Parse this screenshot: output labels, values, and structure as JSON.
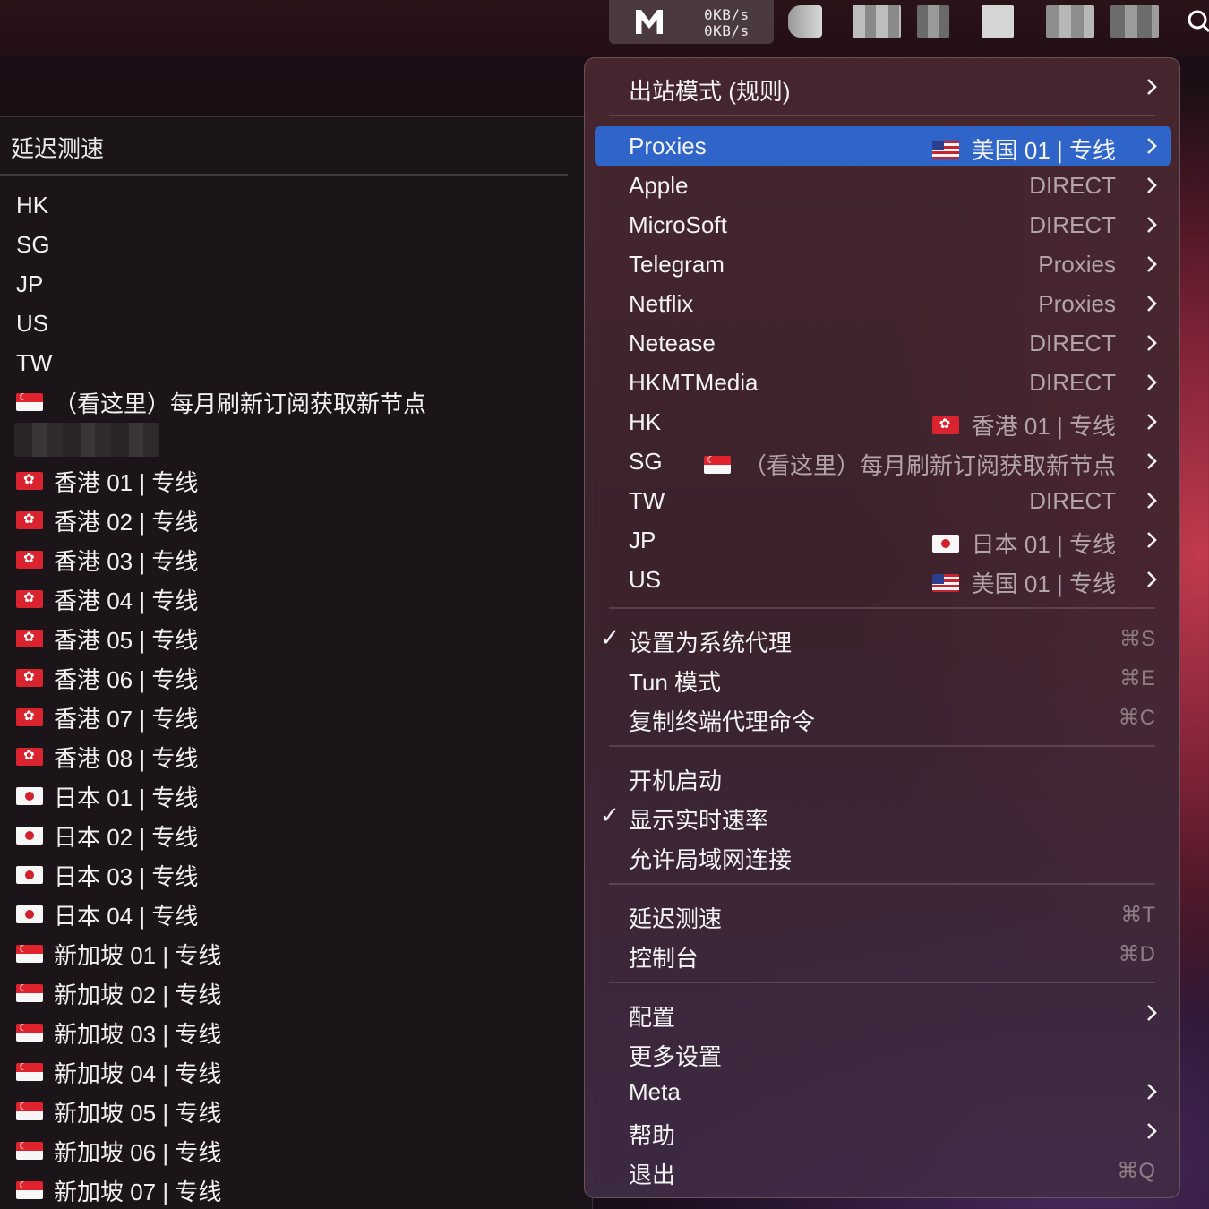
{
  "menubar": {
    "upload_speed": "0KB/s",
    "download_speed": "0KB/s"
  },
  "left_menu": {
    "title": "延迟测速",
    "items": [
      {
        "label": "HK",
        "flag": ""
      },
      {
        "label": "SG",
        "flag": ""
      },
      {
        "label": "JP",
        "flag": ""
      },
      {
        "label": "US",
        "flag": ""
      },
      {
        "label": "TW",
        "flag": ""
      },
      {
        "label": "（看这里）每月刷新订阅获取新节点",
        "flag": "sg"
      },
      {
        "label": "香港 01 | 专线",
        "flag": "hk"
      },
      {
        "label": "香港 02 | 专线",
        "flag": "hk"
      },
      {
        "label": "香港 03 | 专线",
        "flag": "hk"
      },
      {
        "label": "香港 04 | 专线",
        "flag": "hk"
      },
      {
        "label": "香港 05 | 专线",
        "flag": "hk"
      },
      {
        "label": "香港 06 | 专线",
        "flag": "hk"
      },
      {
        "label": "香港 07 | 专线",
        "flag": "hk"
      },
      {
        "label": "香港 08 | 专线",
        "flag": "hk"
      },
      {
        "label": "日本 01 | 专线",
        "flag": "jp"
      },
      {
        "label": "日本 02 | 专线",
        "flag": "jp"
      },
      {
        "label": "日本 03 | 专线",
        "flag": "jp"
      },
      {
        "label": "日本 04 | 专线",
        "flag": "jp"
      },
      {
        "label": "新加坡 01 | 专线",
        "flag": "sg"
      },
      {
        "label": "新加坡 02 | 专线",
        "flag": "sg"
      },
      {
        "label": "新加坡 03 | 专线",
        "flag": "sg"
      },
      {
        "label": "新加坡 04 | 专线",
        "flag": "sg"
      },
      {
        "label": "新加坡 05 | 专线",
        "flag": "sg"
      },
      {
        "label": "新加坡 06 | 专线",
        "flag": "sg"
      },
      {
        "label": "新加坡 07 | 专线",
        "flag": "sg"
      }
    ]
  },
  "right_menu": {
    "mode": {
      "label": "出站模式 (规则)"
    },
    "groups": [
      {
        "label": "Proxies",
        "value": "美国 01 | 专线",
        "flag": "us",
        "highlighted": true
      },
      {
        "label": "Apple",
        "value": "DIRECT",
        "flag": ""
      },
      {
        "label": "MicroSoft",
        "value": "DIRECT",
        "flag": ""
      },
      {
        "label": "Telegram",
        "value": "Proxies",
        "flag": ""
      },
      {
        "label": "Netflix",
        "value": "Proxies",
        "flag": ""
      },
      {
        "label": "Netease",
        "value": "DIRECT",
        "flag": ""
      },
      {
        "label": "HKMTMedia",
        "value": "DIRECT",
        "flag": ""
      },
      {
        "label": "HK",
        "value": "香港 01 | 专线",
        "flag": "hk"
      },
      {
        "label": "SG",
        "value": "（看这里）每月刷新订阅获取新节点",
        "flag": "sg"
      },
      {
        "label": "TW",
        "value": "DIRECT",
        "flag": ""
      },
      {
        "label": "JP",
        "value": "日本 01 | 专线",
        "flag": "jp"
      },
      {
        "label": "US",
        "value": "美国 01 | 专线",
        "flag": "us"
      }
    ],
    "proxy_section": [
      {
        "label": "设置为系统代理",
        "checked": true,
        "shortcut": "⌘S"
      },
      {
        "label": "Tun 模式",
        "checked": false,
        "shortcut": "⌘E"
      },
      {
        "label": "复制终端代理命令",
        "checked": false,
        "shortcut": "⌘C"
      }
    ],
    "startup_section": [
      {
        "label": "开机启动",
        "checked": false
      },
      {
        "label": "显示实时速率",
        "checked": true
      },
      {
        "label": "允许局域网连接",
        "checked": false
      }
    ],
    "tools_section": [
      {
        "label": "延迟测速",
        "shortcut": "⌘T"
      },
      {
        "label": "控制台",
        "shortcut": "⌘D"
      }
    ],
    "bottom_section": [
      {
        "label": "配置",
        "submenu": true,
        "shortcut": ""
      },
      {
        "label": "更多设置",
        "submenu": false,
        "shortcut": ""
      },
      {
        "label": "Meta",
        "submenu": true,
        "shortcut": ""
      },
      {
        "label": "帮助",
        "submenu": true,
        "shortcut": ""
      },
      {
        "label": "退出",
        "submenu": false,
        "shortcut": "⌘Q"
      }
    ]
  }
}
